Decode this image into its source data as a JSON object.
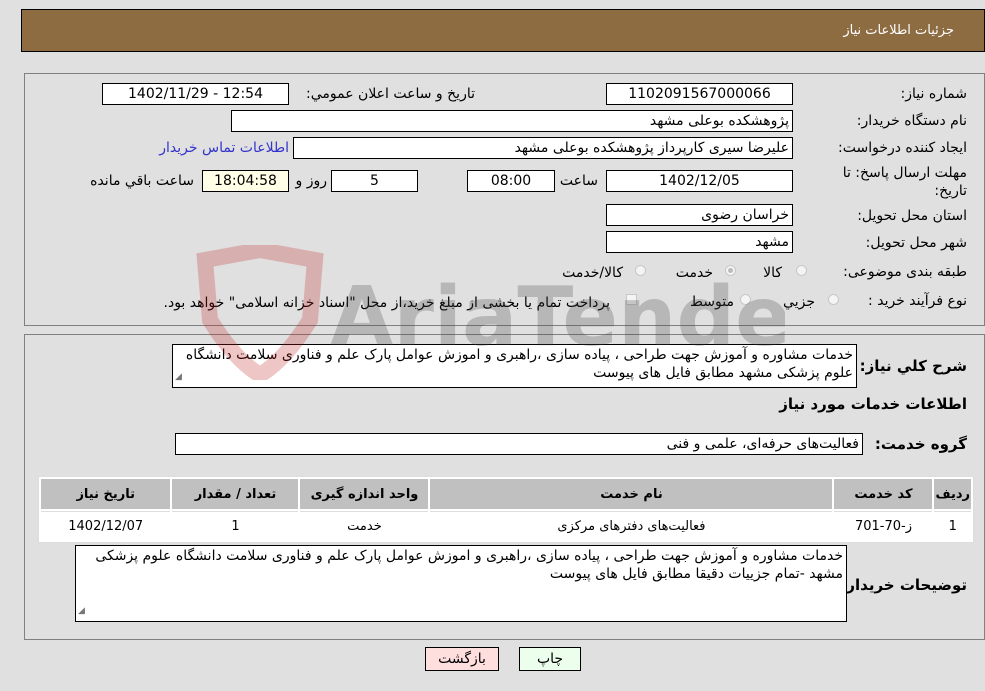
{
  "header": {
    "title": "جزئیات اطلاعات نیاز"
  },
  "fields": {
    "need_number_label": "شماره نیاز:",
    "need_number": "1102091567000066",
    "announce_label": "تاریخ و ساعت اعلان عمومي:",
    "announce_value": "1402/11/29 - 12:54",
    "buyer_org_label": "نام دستگاه خریدار:",
    "buyer_org": "پژوهشکده بوعلی  مشهد",
    "creator_label": "ایجاد کننده درخواست:",
    "creator": "علیرضا سیری کارپرداز پژوهشکده بوعلی  مشهد",
    "contact_link": "اطلاعات تماس خریدار",
    "deadline_label": "مهلت ارسال پاسخ: تا تاریخ:",
    "deadline_date": "1402/12/05",
    "time_label": "ساعت",
    "deadline_time": "08:00",
    "days_value": "5",
    "days_label": "روز و",
    "remaining_value": "18:04:58",
    "remaining_label": "ساعت باقي مانده",
    "province_label": "استان محل تحویل:",
    "province": "خراسان رضوی",
    "city_label": "شهر محل تحویل:",
    "city": "مشهد",
    "category_label": "طبقه بندی موضوعی:",
    "category_options": [
      "کالا",
      "خدمت",
      "کالا/خدمت"
    ],
    "category_selected": "خدمت",
    "process_label": "نوع فرآیند خرید :",
    "process_options": [
      "جزيي",
      "متوسط"
    ],
    "treasury_note": "پرداخت تمام یا بخشی از مبلغ خرید،از محل \"اسناد خزانه اسلامی\" خواهد بود."
  },
  "description": {
    "label": "شرح کلي نياز:",
    "text": "خدمات مشاوره و آموزش جهت طراحی ، پیاده سازی ،راهبری و اموزش عوامل پارک علم و فناوری سلامت دانشگاه علوم پزشکی مشهد  مطابق فایل های پیوست"
  },
  "services": {
    "section_title": "اطلاعات خدمات مورد نیاز",
    "group_label": "گروه خدمت:",
    "group_value": "فعالیت‌های حرفه‌ای، علمی و فنی",
    "table": {
      "headers": [
        "ردیف",
        "کد خدمت",
        "نام خدمت",
        "واحد اندازه گیری",
        "تعداد / مقدار",
        "تاریخ نیاز"
      ],
      "rows": [
        [
          "1",
          "ز-70-701",
          "فعالیت‌های دفترهای مرکزی",
          "خدمت",
          "1",
          "1402/12/07"
        ]
      ]
    }
  },
  "buyer_notes": {
    "label": "توضیحات خریدار:",
    "text": "خدمات مشاوره و آموزش جهت طراحی ، پیاده سازی ،راهبری و اموزش عوامل پارک علم و فناوری سلامت دانشگاه علوم پزشکی مشهد -تمام جزییات دقیقا مطابق فایل های پیوست"
  },
  "buttons": {
    "print": "چاپ",
    "back": "بازگشت"
  },
  "watermark": {
    "text": "AriaTender.neT"
  }
}
